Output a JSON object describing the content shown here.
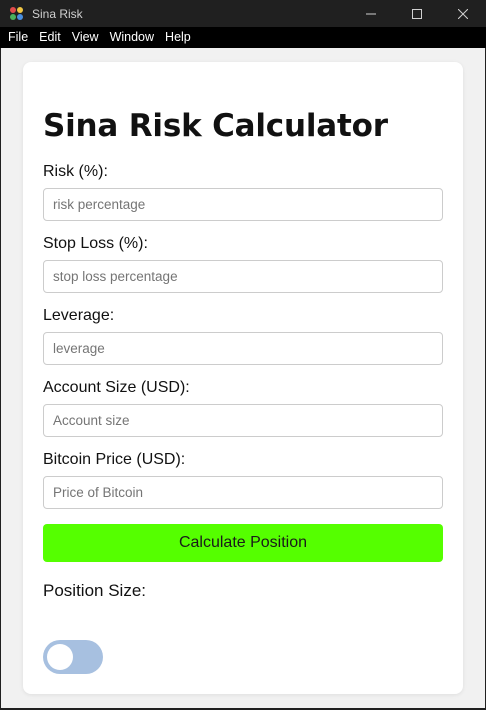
{
  "window": {
    "title": "Sina Risk"
  },
  "menu": {
    "items": [
      "File",
      "Edit",
      "View",
      "Window",
      "Help"
    ]
  },
  "page": {
    "title": "Sina Risk Calculator"
  },
  "fields": [
    {
      "label": "Risk (%):",
      "placeholder": "risk percentage",
      "value": ""
    },
    {
      "label": "Stop Loss (%):",
      "placeholder": "stop loss percentage",
      "value": ""
    },
    {
      "label": "Leverage:",
      "placeholder": "leverage",
      "value": ""
    },
    {
      "label": "Account Size (USD):",
      "placeholder": "Account size",
      "value": ""
    },
    {
      "label": "Bitcoin Price (USD):",
      "placeholder": "Price of Bitcoin",
      "value": ""
    }
  ],
  "calculate_button": {
    "label": "Calculate Position",
    "color": "#55ff00"
  },
  "result": {
    "label": "Position Size:"
  },
  "theme_toggle": {
    "state": "off",
    "track_color": "#a7c0e0"
  },
  "icons": {
    "app": "app-logo-icon",
    "minimize": "minimize-icon",
    "maximize": "maximize-icon",
    "close": "close-icon"
  }
}
